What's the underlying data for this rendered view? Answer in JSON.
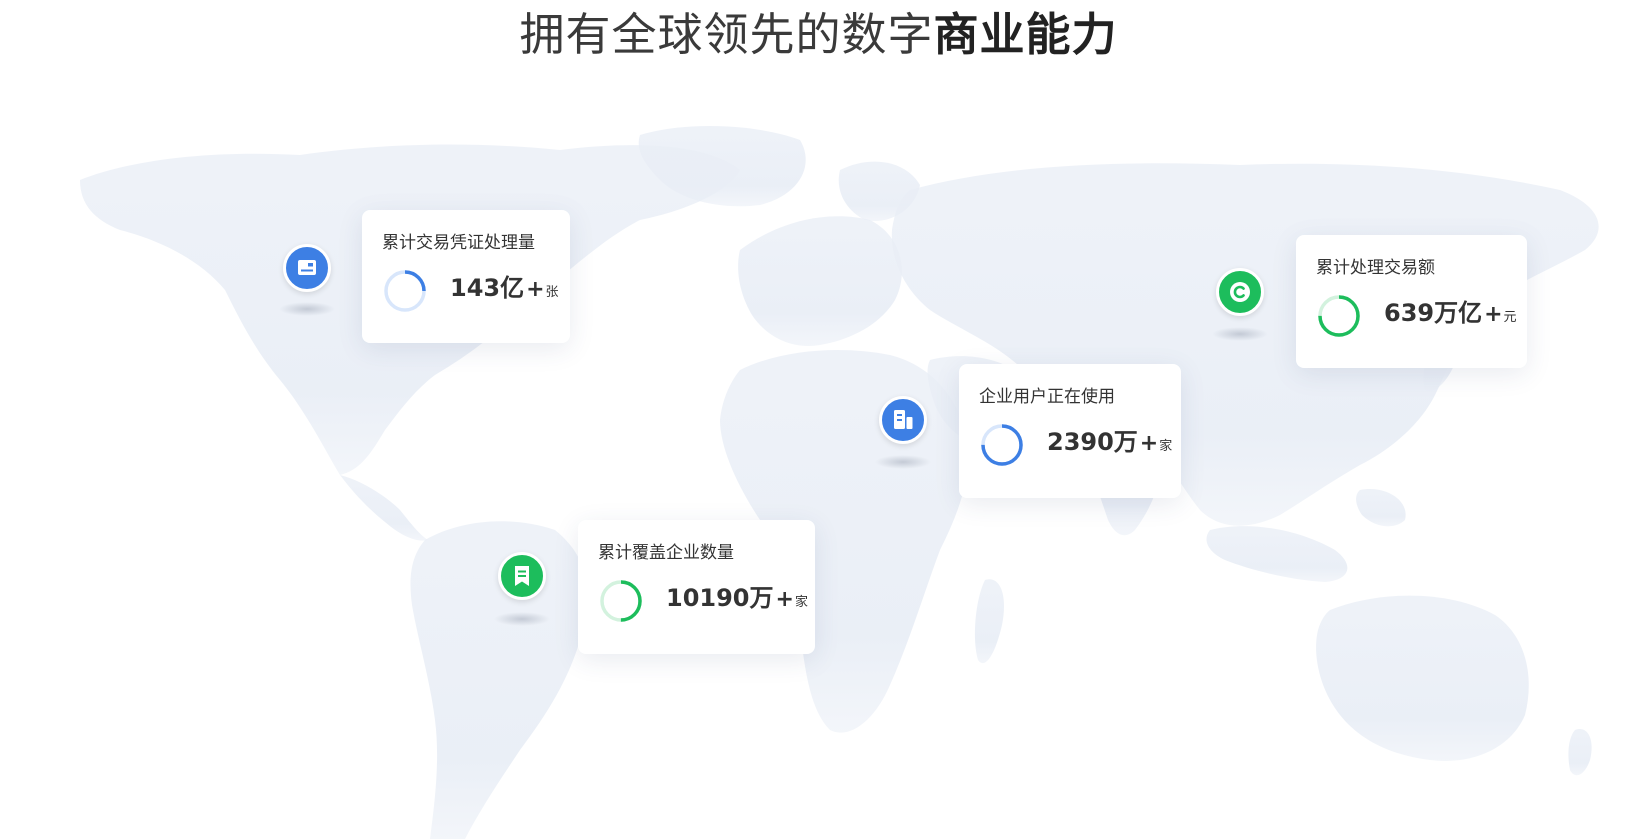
{
  "headline": {
    "light": "拥有全球领先的数字",
    "bold": "商业能力"
  },
  "colors": {
    "blue": "#3d7fe4",
    "blue_light": "#d8e6fb",
    "green": "#1dbd5c",
    "green_light": "#d3f2de",
    "map": "#e9eef6"
  },
  "stats": [
    {
      "label": "累计交易凭证处理量",
      "value": "143亿",
      "plus": "+",
      "unit": "张",
      "icon": "invoice-card-icon",
      "color": "blue",
      "progress": 0.25
    },
    {
      "label": "累计处理交易额",
      "value": "639万亿",
      "plus": "+",
      "unit": "元",
      "icon": "copyright-coin-icon",
      "color": "green",
      "progress": 0.75
    },
    {
      "label": "企业用户正在使用",
      "value": "2390万",
      "plus": "+",
      "unit": "家",
      "icon": "building-icon",
      "color": "blue",
      "progress": 0.75
    },
    {
      "label": "累计覆盖企业数量",
      "value": "10190万",
      "plus": "+",
      "unit": "家",
      "icon": "bookmark-document-icon",
      "color": "green",
      "progress": 0.5
    }
  ]
}
